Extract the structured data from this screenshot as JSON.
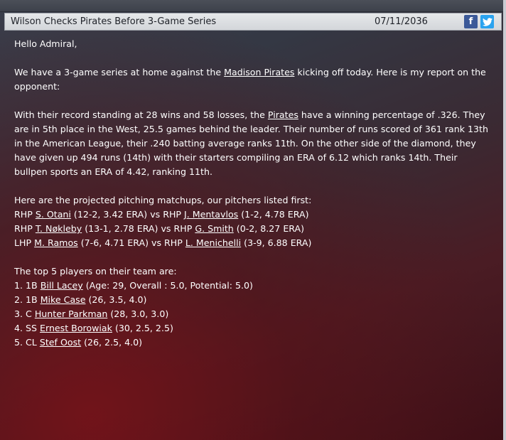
{
  "header": {
    "title": "Wilson Checks Pirates Before 3-Game Series",
    "date": "07/11/2036",
    "facebook_icon": "f",
    "twitter_icon": "twitter-bird"
  },
  "greeting": "Hello Admiral,",
  "intro": {
    "before": "We have a 3-game series at home against the ",
    "team_link": "Madison Pirates",
    "after": " kicking off today. Here is my report on the opponent:"
  },
  "summary": {
    "before": "With their record standing at 28 wins and 58 losses, the ",
    "team_link": "Pirates",
    "after": " have a winning percentage of .326. They are in 5th place in the West, 25.5 games behind the leader. Their number of runs scored of 361 rank 13th in the American League, their .240 batting average ranks 11th. On the other side of the diamond, they have given up 494 runs (14th) with their starters compiling an ERA of 6.12 which ranks 14th. Their bullpen sports an ERA of 4.42, ranking 11th."
  },
  "matchups": {
    "heading": "Here are the projected pitching matchups, our pitchers listed first:",
    "rows": [
      {
        "our_hand": "RHP",
        "our_name": "S. Otani",
        "our_stats": "(12-2, 3.42 ERA) vs RHP",
        "their_name": "J. Mentavlos",
        "their_stats": "(1-2, 4.78 ERA)"
      },
      {
        "our_hand": "RHP",
        "our_name": "T. Nøkleby",
        "our_stats": "(13-1, 2.78 ERA) vs RHP",
        "their_name": "G. Smith",
        "their_stats": "(0-2, 8.27 ERA)"
      },
      {
        "our_hand": "LHP",
        "our_name": "M. Ramos",
        "our_stats": "(7-6, 4.71 ERA) vs RHP",
        "their_name": "L. Menichelli",
        "their_stats": "(3-9, 6.88 ERA)"
      }
    ]
  },
  "top_players": {
    "heading": "The top 5 players on their team are:",
    "rows": [
      {
        "prefix": "1. 1B",
        "name": "Bill Lacey",
        "stats": "(Age: 29, Overall : 5.0, Potential: 5.0)"
      },
      {
        "prefix": "2. 1B",
        "name": "Mike Case",
        "stats": "(26, 3.5, 4.0)"
      },
      {
        "prefix": "3. C",
        "name": "Hunter Parkman",
        "stats": "(28, 3.0, 3.0)"
      },
      {
        "prefix": "4. SS",
        "name": "Ernest Borowiak",
        "stats": "(30, 2.5, 2.5)"
      },
      {
        "prefix": "5. CL",
        "name": "Stef Oost",
        "stats": "(26, 2.5, 4.0)"
      }
    ]
  }
}
